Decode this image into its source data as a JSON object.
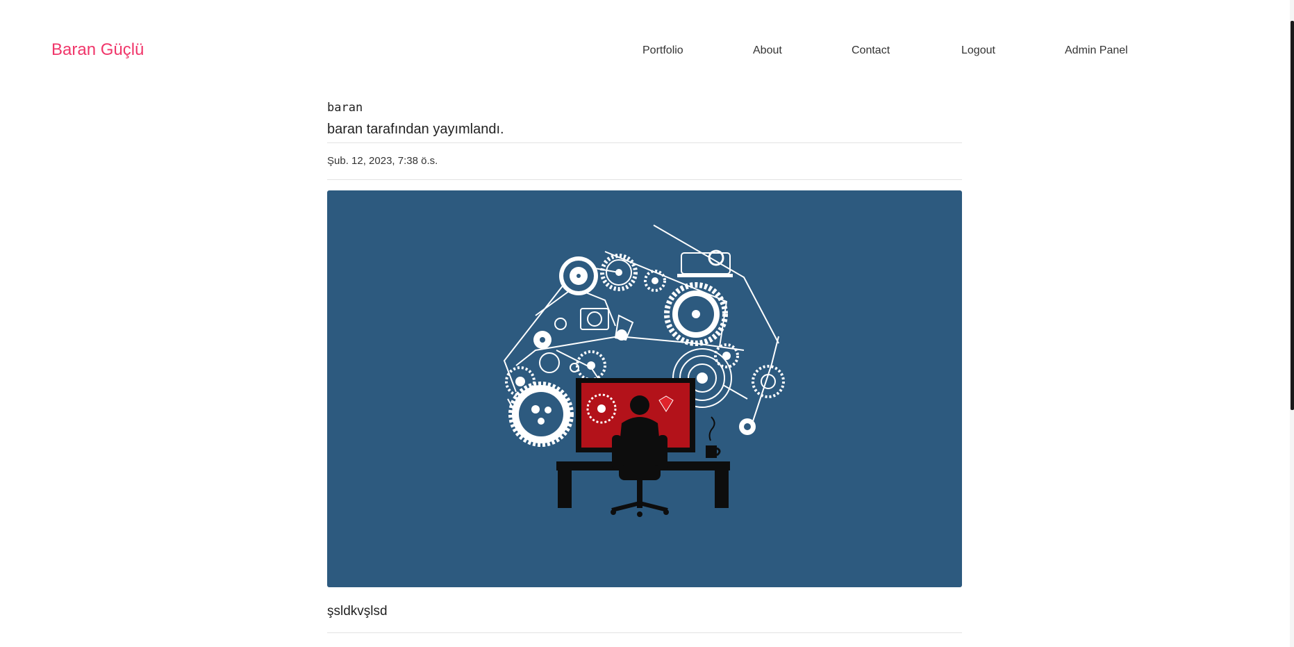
{
  "nav": {
    "brand": "Baran Güçlü",
    "links": [
      {
        "label": "Portfolio"
      },
      {
        "label": "About"
      },
      {
        "label": "Contact"
      },
      {
        "label": "Logout"
      },
      {
        "label": "Admin Panel"
      }
    ]
  },
  "post": {
    "title": "baran",
    "byline": "baran tarafından yayımlandı.",
    "date": "Şub. 12, 2023, 7:38 ö.s.",
    "body": "şsldkvşlsd"
  },
  "colors": {
    "brand": "#f0366a",
    "hero_background": "#2d5a7f",
    "screen_red": "#b3121a"
  },
  "icons": {
    "hero": "programmer-with-gears-illustration"
  }
}
